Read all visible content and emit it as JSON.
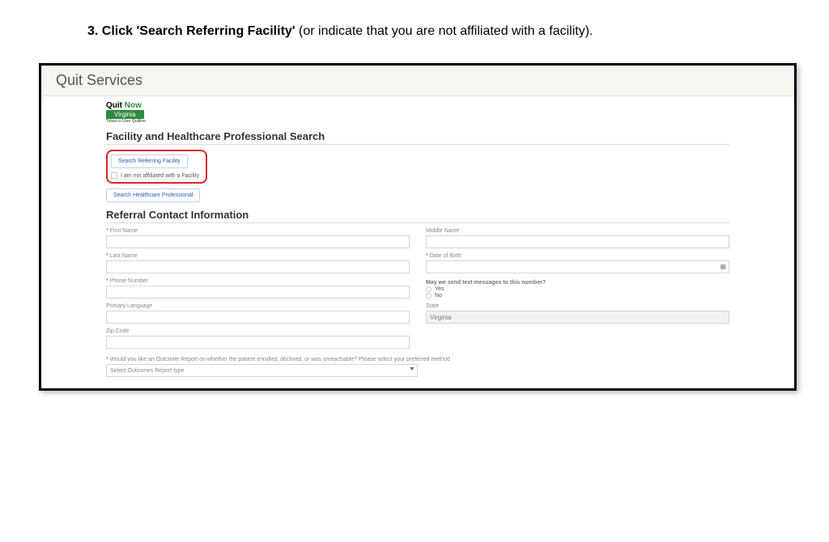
{
  "instruction": {
    "bold": "3. Click 'Search Referring Facility'",
    "rest": " (or indicate that you are not affiliated with a facility)."
  },
  "topbar": {
    "title": "Quit Services"
  },
  "logo": {
    "line1a": "Quit ",
    "line1b": "Now",
    "pill": "Virginia",
    "sub": "Tobacco User Quitline"
  },
  "sections": {
    "facility_title": "Facility and Healthcare Professional Search",
    "referral_title": "Referral Contact Information"
  },
  "buttons": {
    "search_facility": "Search Referring Facility",
    "not_affiliated": "I am not affiliated with a Facility",
    "search_hcp": "Search Healthcare Professional"
  },
  "fields": {
    "first_name": "First Name",
    "middle_name": "Middle Name",
    "last_name": "Last Name",
    "dob": "Date of Birth",
    "phone": "Phone Number",
    "text_q": "May we send text messages to this number?",
    "yes": "Yes",
    "no": "No",
    "primary_lang": "Primary Language",
    "state": "State",
    "state_value": "Virginia",
    "zip": "Zip Code",
    "outcome_q": "Would you like an Outcome Report on whether the patient enrolled, declined, or was unreachable? Please select your preferred method",
    "outcome_placeholder": "Select Outcomes Report type"
  }
}
